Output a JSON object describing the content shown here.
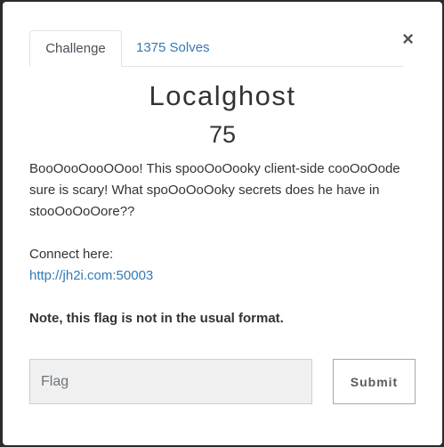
{
  "tabs": [
    {
      "label": "Challenge",
      "active": true
    },
    {
      "label": "1375 Solves",
      "active": false
    }
  ],
  "close_icon": "×",
  "challenge": {
    "title": "Localghost",
    "points": "75",
    "description": "BooOooOooOOoo! This spooOoOooky client-side cooOoOode sure is scary! What spoOoOoOoky secrets does he have in stooOoOoOore??",
    "connect_label": "Connect here:",
    "connect_link": "http://jh2i.com:50003",
    "note": "Note, this flag is not in the usual format."
  },
  "form": {
    "flag_placeholder": "Flag",
    "submit_label": "Submit"
  },
  "colors": {
    "link": "#337ab7",
    "input_bg": "#f0f0f0"
  }
}
